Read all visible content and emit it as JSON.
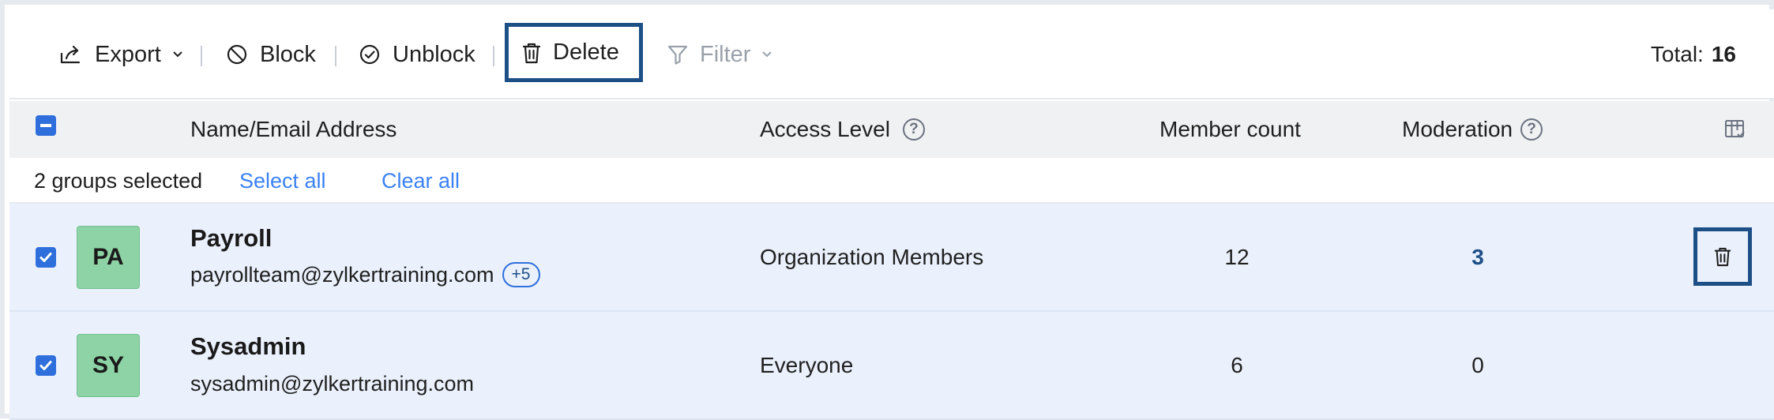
{
  "toolbar": {
    "export_label": "Export",
    "block_label": "Block",
    "unblock_label": "Unblock",
    "delete_label": "Delete",
    "filter_label": "Filter",
    "total_label": "Total:",
    "total_count": "16"
  },
  "table": {
    "columns": {
      "name": "Name/Email Address",
      "access": "Access Level",
      "members": "Member count",
      "moderation": "Moderation"
    },
    "selection": {
      "summary": "2 groups selected",
      "select_all": "Select all",
      "clear_all": "Clear all"
    },
    "rows": [
      {
        "initials": "PA",
        "name": "Payroll",
        "email": "payrollteam@zylkertraining.com",
        "extra": "+5",
        "access": "Organization Members",
        "members": "12",
        "moderation": "3"
      },
      {
        "initials": "SY",
        "name": "Sysadmin",
        "email": "sysadmin@zylkertraining.com",
        "access": "Everyone",
        "members": "6",
        "moderation": "0"
      }
    ]
  },
  "colors": {
    "accent": "#2e6fdc",
    "highlight_border": "#1d4f87",
    "row_selected_bg": "#eaf1fc",
    "avatar_bg": "#8dd3a5",
    "link": "#3b82f6"
  },
  "icons": {
    "export": "export-icon",
    "block": "block-icon",
    "unblock": "check-circle-icon",
    "delete": "trash-icon",
    "filter": "filter-icon",
    "columns": "column-settings-icon",
    "help": "question-icon"
  }
}
